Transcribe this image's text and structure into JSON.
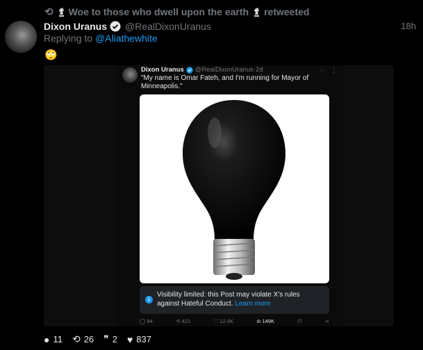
{
  "retweet": {
    "icon": "retweet-icon",
    "text": "Woe to those who dwell upon the earth",
    "suffix": "retweeted"
  },
  "tweet": {
    "display_name": "Dixon Uranus",
    "handle": "@RealDixonUranus",
    "time": "18h",
    "replying_prefix": "Replying to",
    "replying_to": "@Aliathewhite",
    "body_emoji": "🙄"
  },
  "quoted": {
    "display_name": "Dixon Uranus",
    "handle": "@RealDixonUranus",
    "separator": "·",
    "time": "2d",
    "text": "\"My name is Omar Fateh, and I'm running for Mayor of Minneapolis.\"",
    "visibility_text": "Visibility limited: this Post may violate X's rules against Hateful Conduct.",
    "visibility_link": "Learn more",
    "actions": {
      "replies": "84",
      "retweets": "421",
      "likes": "12.6K",
      "views": "149K"
    }
  },
  "actions": {
    "replies": "11",
    "retweets": "26",
    "quotes": "2",
    "likes": "837"
  },
  "colors": {
    "background": "#000000",
    "accent": "#1d9bf0",
    "muted": "#71767b"
  }
}
